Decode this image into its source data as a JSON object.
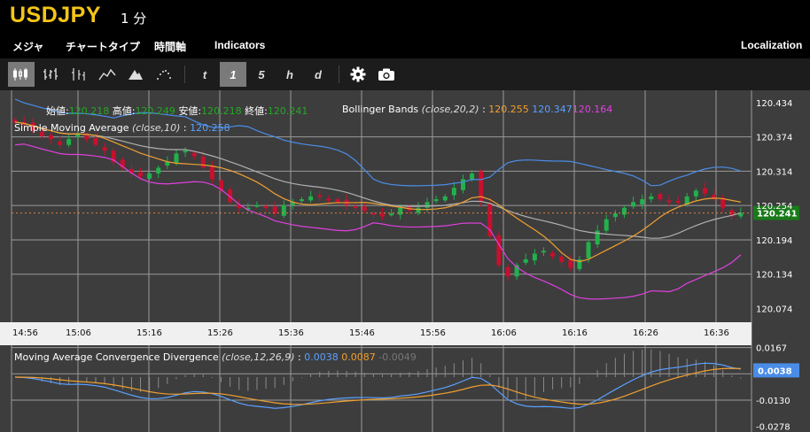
{
  "header": {
    "symbol": "USDJPY",
    "interval": "1 分"
  },
  "menu": [
    {
      "label": "メジャ"
    },
    {
      "label": "チャートタイプ"
    },
    {
      "label": "時間軸"
    },
    {
      "label": "Indicators"
    },
    {
      "label": "Localization"
    }
  ],
  "toolbar": {
    "chart_types": [
      "candlestick-icon",
      "ohlc-icon",
      "hollow-candle-icon",
      "line-chart-icon",
      "mountain-icon",
      "dots-icon"
    ],
    "periods": [
      {
        "label": "t",
        "active": false
      },
      {
        "label": "1",
        "active": true
      },
      {
        "label": "5",
        "active": false
      },
      {
        "label": "h",
        "active": false
      },
      {
        "label": "d",
        "active": false
      }
    ],
    "settings_icon": "gear-icon",
    "snapshot_icon": "camera-icon"
  },
  "legend": {
    "ohlc": {
      "open_label": "始値:",
      "open": "120.218",
      "high_label": "高値:",
      "high": "120.249",
      "low_label": "安値:",
      "low": "120.218",
      "close_label": "終値:",
      "close": "120.241"
    },
    "bollinger": {
      "name": "Bollinger Bands",
      "params": "(close,20,2)",
      "sep": ":",
      "mid": "120.255",
      "upper": "120.347",
      "lower": "120.164"
    },
    "sma": {
      "name": "Simple Moving Average",
      "params": "(close,10)",
      "sep": ":",
      "value": "120.258"
    },
    "macd": {
      "name": "Moving Average Convergence Divergence",
      "params": "(close,12,26,9)",
      "sep": ":",
      "macd": "0.0038",
      "signal": "0.0087",
      "hist": "-0.0049"
    }
  },
  "price_axis": {
    "labels": [
      "120.434",
      "120.374",
      "120.314",
      "120.254",
      "120.194",
      "120.134",
      "120.074"
    ],
    "current": "120.241"
  },
  "macd_axis": {
    "labels": [
      "0.0167",
      "-0.0130",
      "-0.0278"
    ],
    "current": "0.0038"
  },
  "time_axis": [
    "14:56",
    "15:06",
    "15:16",
    "15:26",
    "15:36",
    "15:46",
    "15:56",
    "16:06",
    "16:16",
    "16:26",
    "16:36"
  ],
  "colors": {
    "up": "#22b14c",
    "down": "#c8102e",
    "sma": "#f0a030",
    "bb_mid": "#b0b0b0",
    "bb_upper": "#4a8de8",
    "bb_lower": "#e040e0",
    "macd": "#5aa0ff",
    "signal": "#f0a030",
    "background": "#3d3d3d"
  },
  "chart_data": {
    "type": "candlestick",
    "y_range": [
      120.05,
      120.44
    ],
    "closes": [
      120.4,
      120.395,
      120.385,
      120.375,
      120.37,
      120.36,
      120.37,
      120.38,
      120.37,
      120.36,
      120.35,
      120.33,
      120.32,
      120.31,
      120.305,
      120.31,
      120.32,
      120.33,
      120.345,
      120.35,
      120.34,
      120.32,
      120.3,
      120.28,
      120.26,
      120.25,
      120.25,
      120.255,
      120.25,
      120.24,
      120.255,
      120.26,
      120.265,
      120.27,
      120.27,
      120.265,
      120.26,
      120.255,
      120.25,
      120.245,
      120.24,
      120.235,
      120.24,
      120.25,
      120.245,
      120.25,
      120.26,
      120.265,
      120.27,
      120.285,
      120.3,
      120.31,
      120.26,
      120.2,
      120.15,
      120.13,
      120.15,
      120.16,
      120.17,
      120.175,
      120.165,
      120.155,
      120.145,
      120.16,
      120.19,
      120.21,
      120.23,
      120.24,
      120.25,
      120.26,
      120.265,
      120.27,
      120.265,
      120.26,
      120.26,
      120.27,
      120.28,
      120.275,
      120.265,
      120.25,
      120.235,
      120.241
    ]
  }
}
